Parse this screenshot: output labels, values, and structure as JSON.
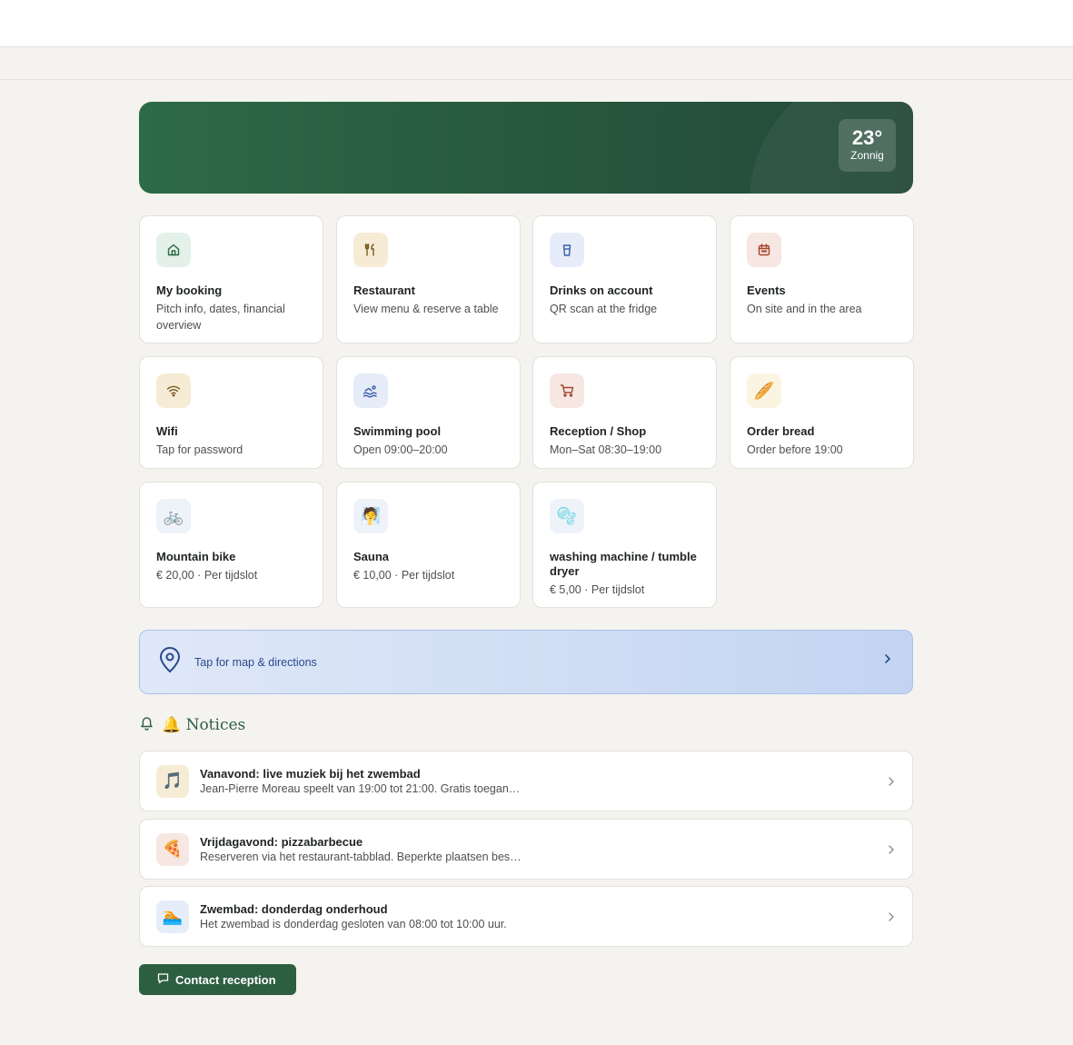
{
  "weather": {
    "temp": "23°",
    "condition": "Zonnig"
  },
  "cards": [
    {
      "title": "My booking",
      "subtitle": "Pitch info, dates, financial overview",
      "icon": "home-icon",
      "icon_bg": "#e3f1ea"
    },
    {
      "title": "Restaurant",
      "subtitle": "View menu & reserve a table",
      "icon": "fork-knife-icon",
      "icon_bg": "#f6ecd6"
    },
    {
      "title": "Drinks on account",
      "subtitle": "QR scan at the fridge",
      "icon": "cup-icon",
      "icon_bg": "#e6edf9"
    },
    {
      "title": "Events",
      "subtitle": "On site and in the area",
      "icon": "calendar-icon",
      "icon_bg": "#f6e7e2"
    },
    {
      "title": "Wifi",
      "subtitle": "Tap for password",
      "icon": "wifi-icon",
      "icon_bg": "#f6ecd6"
    },
    {
      "title": "Swimming pool",
      "subtitle": "Open 09:00–20:00",
      "icon": "swimmer-icon",
      "icon_bg": "#e6edf9"
    },
    {
      "title": "Reception / Shop",
      "subtitle": "Mon–Sat 08:30–19:00",
      "icon": "cart-icon",
      "icon_bg": "#f6e7e2"
    },
    {
      "title": "Order bread",
      "subtitle": "Order before 19:00",
      "icon": "bread-icon",
      "icon_bg": "#fbf4e0",
      "emoji": "🥖"
    },
    {
      "title": "Mountain bike",
      "subtitle": "€ 20,00 · Per tijdslot",
      "icon": "bicycle-icon",
      "icon_bg": "#eef2f9",
      "emoji": "🚲"
    },
    {
      "title": "Sauna",
      "subtitle": "€ 10,00 · Per tijdslot",
      "icon": "sauna-icon",
      "icon_bg": "#eef2f9",
      "emoji": "🧖"
    },
    {
      "title": "washing machine / tumble dryer",
      "subtitle": "€ 5,00 · Per tijdslot",
      "icon": "bubbles-icon",
      "icon_bg": "#eef2f9",
      "emoji": "🫧"
    }
  ],
  "map": {
    "label": "Tap for map & directions"
  },
  "notices": {
    "title": "🔔 Notices",
    "items": [
      {
        "title": "Vanavond: live muziek bij het zwembad",
        "text": "Jean-Pierre Moreau speelt van 19:00 tot 21:00. Gratis toegan…",
        "icon": "music-note-icon",
        "icon_bg": "#f6ecd6",
        "emoji": "🎵"
      },
      {
        "title": "Vrijdagavond: pizzabarbecue",
        "text": "Reserveren via het restaurant-tabblad. Beperkte plaatsen bes…",
        "icon": "pizza-icon",
        "icon_bg": "#f6e7e2",
        "emoji": "🍕"
      },
      {
        "title": "Zwembad: donderdag onderhoud",
        "text": "Het zwembad is donderdag gesloten van 08:00 tot 10:00 uur.",
        "icon": "swimmer-icon",
        "icon_bg": "#e6edf9",
        "emoji": "🏊"
      }
    ]
  },
  "contact": {
    "label": "Contact reception"
  },
  "colors": {
    "brand": "#2d5e40",
    "hero_start": "#2d6a47",
    "hero_end": "#24493a",
    "map_border": "#a9c1ea"
  }
}
